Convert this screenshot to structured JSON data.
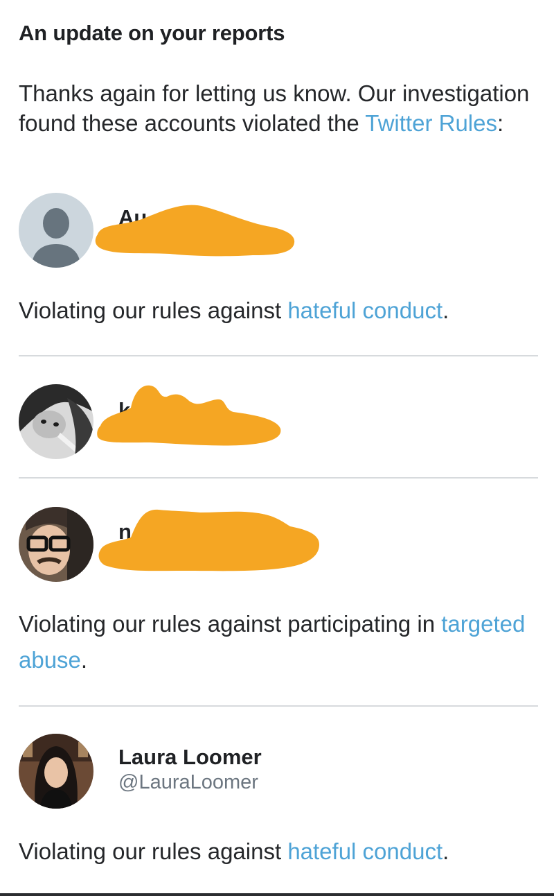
{
  "header": {
    "title": "An update on your reports"
  },
  "intro": {
    "text": "Thanks again for letting us know. Our investigation found these accounts violated the",
    "link": "Twitter Rules",
    "suffix": ":"
  },
  "accounts": [
    {
      "name_visible": "Au",
      "redacted": true
    },
    {
      "name_visible": "k",
      "redacted": true
    },
    {
      "name_visible": "n",
      "redacted": true
    },
    {
      "name": "Laura Loomer",
      "handle": "@LauraLoomer",
      "redacted": false
    }
  ],
  "reasons": [
    {
      "prefix": "Violating our rules against ",
      "link": "hateful conduct",
      "suffix": "."
    },
    {
      "prefix": "Violating our rules against participating in ",
      "link": "targeted abuse",
      "suffix": "."
    },
    {
      "prefix": "Violating our rules against ",
      "link": "hateful conduct",
      "suffix": "."
    }
  ],
  "colors": {
    "link": "#4ea3d6",
    "redaction": "#f5a623",
    "divider": "#d7dadd"
  }
}
